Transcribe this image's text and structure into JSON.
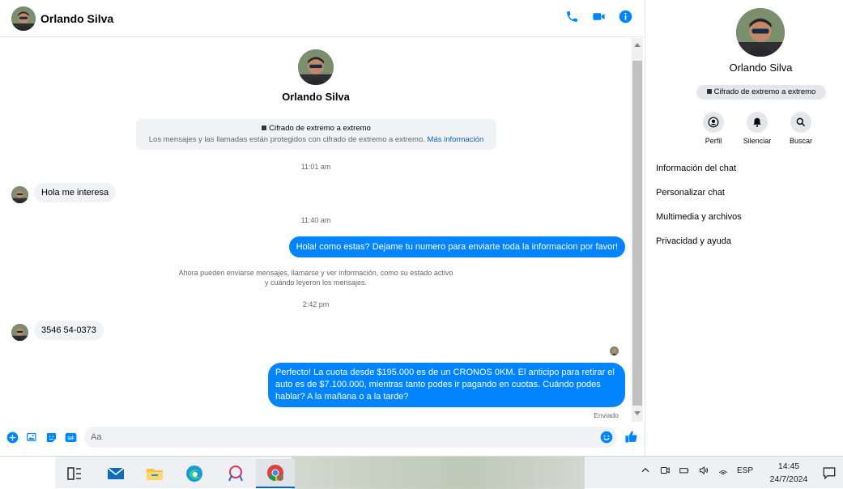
{
  "header": {
    "contact_name": "Orlando Silva",
    "icons": [
      "phone-icon",
      "video-call-icon",
      "info-icon"
    ]
  },
  "conversation_intro": {
    "name": "Orlando Silva",
    "encryption_title": "Cifrado de extremo a extremo",
    "encryption_desc": "Los mensajes y las llamadas están protegidos con cifrado de extremo a extremo.",
    "encryption_link": "Más información"
  },
  "messages": [
    {
      "type": "timestamp",
      "text": "11:01 am"
    },
    {
      "type": "incoming",
      "text": "Hola me interesa"
    },
    {
      "type": "timestamp",
      "text": "11:40 am"
    },
    {
      "type": "outgoing",
      "text": "Hola! como estas? Dejame tu numero para enviarte toda la informacion por favor!"
    },
    {
      "type": "system",
      "text": "Ahora pueden enviarse mensajes, llamarse y ver información, como su estado activo y cuándo leyeron los mensajes."
    },
    {
      "type": "timestamp",
      "text": "2:42 pm"
    },
    {
      "type": "incoming",
      "text": "3546 54-0373"
    },
    {
      "type": "outgoing",
      "text": "Perfecto! La cuota desde $195.000 es de un CRONOS 0KM. El anticipo para retirar el auto es de $7.100.000, mientras tanto podes ir pagando en cuotas. Cuándo podes hablar? A la mañana o a la tarde?"
    },
    {
      "type": "status",
      "text": "Enviado"
    }
  ],
  "composer": {
    "placeholder": "Aa",
    "icons": [
      "add-icon",
      "photo-icon",
      "sticker-icon",
      "gif-icon",
      "emoji-icon",
      "like-icon"
    ],
    "gif_label": "GIF"
  },
  "panel": {
    "name": "Orlando Silva",
    "badge": "Cifrado de extremo a extremo",
    "actions": [
      {
        "label": "Perfil",
        "icon": "profile-icon"
      },
      {
        "label": "Silenciar",
        "icon": "bell-icon"
      },
      {
        "label": "Buscar",
        "icon": "search-icon"
      }
    ],
    "menu": [
      "Información del chat",
      "Personalizar chat",
      "Multimedia y archivos",
      "Privacidad y ayuda"
    ]
  },
  "taskbar": {
    "apps": [
      "task-view-icon",
      "mail-icon",
      "file-explorer-icon",
      "edge-icon",
      "snipping-tool-icon",
      "chrome-icon"
    ],
    "language": "ESP",
    "time": "14:45",
    "date": "24/7/2024"
  },
  "colors": {
    "accent": "#0084ff",
    "incoming_bubble": "#f0f2f5",
    "link": "#0a66c2"
  }
}
